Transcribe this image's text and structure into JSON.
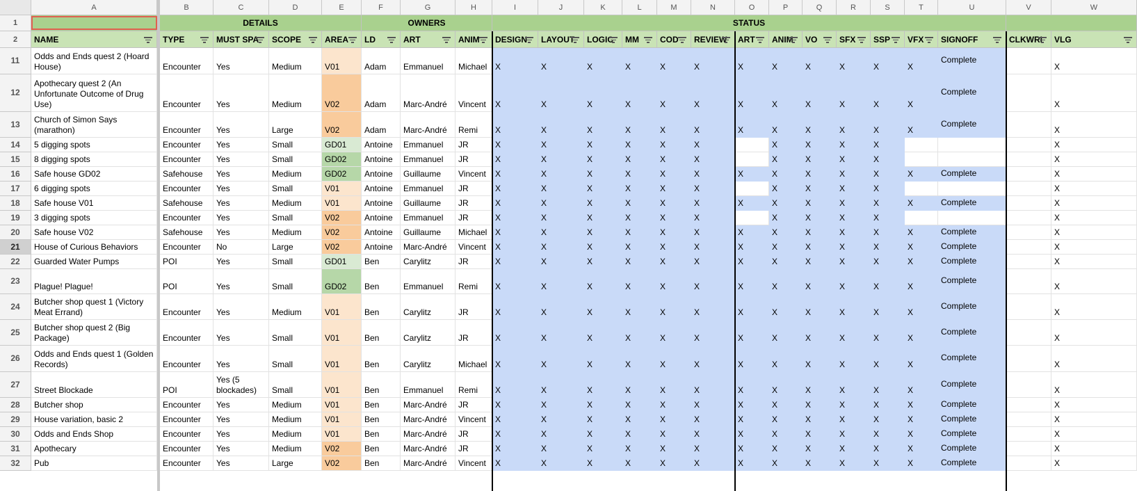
{
  "columns": {
    "letters": [
      "A",
      "B",
      "C",
      "D",
      "E",
      "F",
      "G",
      "H",
      "I",
      "J",
      "K",
      "L",
      "M",
      "N",
      "O",
      "P",
      "Q",
      "R",
      "S",
      "T",
      "U",
      "V",
      "W"
    ]
  },
  "groups": {
    "row_number": "1",
    "details": "DETAILS",
    "owners": "OWNERS",
    "status": "STATUS"
  },
  "headers": {
    "row_number": "2",
    "labels": [
      "NAME",
      "TYPE",
      "MUST SPA",
      "SCOPE",
      "AREA",
      "LD",
      "ART",
      "ANIM",
      "DESIGN",
      "LAYOUT",
      "LOGIC",
      "MM",
      "COD",
      "REVIEW",
      "ART",
      "ANIM",
      "VO",
      "SFX",
      "SSP",
      "VFX",
      "SIGNOFF",
      "CLKWRI",
      "VLG"
    ]
  },
  "rows": [
    {
      "n": "11",
      "name": "Odds and Ends quest 2 (Hoard House)",
      "type": "Encounter",
      "must": "Yes",
      "scope": "Medium",
      "area": "V01",
      "ld": "Adam",
      "art": "Emmanuel",
      "anim": "Michael",
      "design": "X",
      "layout": "X",
      "logic": "X",
      "mm": "X",
      "cod": "X",
      "review": "X",
      "art2": "X",
      "anim2": "X",
      "vo": "X",
      "sfx": "X",
      "ssp": "X",
      "vfx": "X",
      "signoff": "Complete",
      "clk": "",
      "vlg": "X"
    },
    {
      "n": "12",
      "name": "Apothecary quest 2 (An Unfortunate Outcome of Drug Use)",
      "type": "Encounter",
      "must": "Yes",
      "scope": "Medium",
      "area": "V02",
      "ld": "Adam",
      "art": "Marc-André",
      "anim": "Vincent",
      "design": "X",
      "layout": "X",
      "logic": "X",
      "mm": "X",
      "cod": "X",
      "review": "X",
      "art2": "X",
      "anim2": "X",
      "vo": "X",
      "sfx": "X",
      "ssp": "X",
      "vfx": "X",
      "signoff": "Complete",
      "clk": "",
      "vlg": "X"
    },
    {
      "n": "13",
      "name": "Church of Simon Says (marathon)",
      "type": "Encounter",
      "must": "Yes",
      "scope": "Large",
      "area": "V02",
      "ld": "Adam",
      "art": "Marc-André",
      "anim": "Remi",
      "design": "X",
      "layout": "X",
      "logic": "X",
      "mm": "X",
      "cod": "X",
      "review": "X",
      "art2": "X",
      "anim2": "X",
      "vo": "X",
      "sfx": "X",
      "ssp": "X",
      "vfx": "X",
      "signoff": "Complete",
      "clk": "",
      "vlg": "X"
    },
    {
      "n": "14",
      "name": "5 digging spots",
      "type": "Encounter",
      "must": "Yes",
      "scope": "Small",
      "area": "GD01",
      "ld": "Antoine",
      "art": "Emmanuel",
      "anim": "JR",
      "design": "X",
      "layout": "X",
      "logic": "X",
      "mm": "X",
      "cod": "X",
      "review": "X",
      "art2": "",
      "anim2": "X",
      "vo": "X",
      "sfx": "X",
      "ssp": "X",
      "vfx": "",
      "signoff": "",
      "clk": "",
      "vlg": "X"
    },
    {
      "n": "15",
      "name": "8 digging spots",
      "type": "Encounter",
      "must": "Yes",
      "scope": "Small",
      "area": "GD02",
      "ld": "Antoine",
      "art": "Emmanuel",
      "anim": "JR",
      "design": "X",
      "layout": "X",
      "logic": "X",
      "mm": "X",
      "cod": "X",
      "review": "X",
      "art2": "",
      "anim2": "X",
      "vo": "X",
      "sfx": "X",
      "ssp": "X",
      "vfx": "",
      "signoff": "",
      "clk": "",
      "vlg": "X"
    },
    {
      "n": "16",
      "name": "Safe house GD02",
      "type": "Safehouse",
      "must": "Yes",
      "scope": "Medium",
      "area": "GD02",
      "ld": "Antoine",
      "art": "Guillaume",
      "anim": "Vincent",
      "design": "X",
      "layout": "X",
      "logic": "X",
      "mm": "X",
      "cod": "X",
      "review": "X",
      "art2": "X",
      "anim2": "X",
      "vo": "X",
      "sfx": "X",
      "ssp": "X",
      "vfx": "X",
      "signoff": "Complete",
      "clk": "",
      "vlg": "X"
    },
    {
      "n": "17",
      "name": "6 digging spots",
      "type": "Encounter",
      "must": "Yes",
      "scope": "Small",
      "area": "V01",
      "ld": "Antoine",
      "art": "Emmanuel",
      "anim": "JR",
      "design": "X",
      "layout": "X",
      "logic": "X",
      "mm": "X",
      "cod": "X",
      "review": "X",
      "art2": "",
      "anim2": "X",
      "vo": "X",
      "sfx": "X",
      "ssp": "X",
      "vfx": "",
      "signoff": "",
      "clk": "",
      "vlg": "X"
    },
    {
      "n": "18",
      "name": "Safe house V01",
      "type": "Safehouse",
      "must": "Yes",
      "scope": "Medium",
      "area": "V01",
      "ld": "Antoine",
      "art": "Guillaume",
      "anim": "JR",
      "design": "X",
      "layout": "X",
      "logic": "X",
      "mm": "X",
      "cod": "X",
      "review": "X",
      "art2": "X",
      "anim2": "X",
      "vo": "X",
      "sfx": "X",
      "ssp": "X",
      "vfx": "X",
      "signoff": "Complete",
      "clk": "",
      "vlg": "X"
    },
    {
      "n": "19",
      "name": "3 digging spots",
      "type": "Encounter",
      "must": "Yes",
      "scope": "Small",
      "area": "V02",
      "ld": "Antoine",
      "art": "Emmanuel",
      "anim": "JR",
      "design": "X",
      "layout": "X",
      "logic": "X",
      "mm": "X",
      "cod": "X",
      "review": "X",
      "art2": "",
      "anim2": "X",
      "vo": "X",
      "sfx": "X",
      "ssp": "X",
      "vfx": "",
      "signoff": "",
      "clk": "",
      "vlg": "X"
    },
    {
      "n": "20",
      "name": "Safe house V02",
      "type": "Safehouse",
      "must": "Yes",
      "scope": "Medium",
      "area": "V02",
      "ld": "Antoine",
      "art": "Guillaume",
      "anim": "Michael",
      "design": "X",
      "layout": "X",
      "logic": "X",
      "mm": "X",
      "cod": "X",
      "review": "X",
      "art2": "X",
      "anim2": "X",
      "vo": "X",
      "sfx": "X",
      "ssp": "X",
      "vfx": "X",
      "signoff": "Complete",
      "clk": "",
      "vlg": "X"
    },
    {
      "n": "21",
      "name": "House of Curious Behaviors",
      "type": "Encounter",
      "must": "No",
      "scope": "Large",
      "area": "V02",
      "ld": "Antoine",
      "art": "Marc-André",
      "anim": "Vincent",
      "design": "X",
      "layout": "X",
      "logic": "X",
      "mm": "X",
      "cod": "X",
      "review": "X",
      "art2": "X",
      "anim2": "X",
      "vo": "X",
      "sfx": "X",
      "ssp": "X",
      "vfx": "X",
      "signoff": "Complete",
      "clk": "",
      "vlg": "X"
    },
    {
      "n": "22",
      "name": "Guarded Water Pumps",
      "type": "POI",
      "must": "Yes",
      "scope": "Small",
      "area": "GD01",
      "ld": "Ben",
      "art": "Carylitz",
      "anim": "JR",
      "design": "X",
      "layout": "X",
      "logic": "X",
      "mm": "X",
      "cod": "X",
      "review": "X",
      "art2": "X",
      "anim2": "X",
      "vo": "X",
      "sfx": "X",
      "ssp": "X",
      "vfx": "X",
      "signoff": "Complete",
      "clk": "",
      "vlg": "X"
    },
    {
      "n": "23",
      "name": "Plague! Plague!",
      "type": "POI",
      "must": "Yes",
      "scope": "Small",
      "area": "GD02",
      "ld": "Ben",
      "art": "Emmanuel",
      "anim": "Remi",
      "design": "X",
      "layout": "X",
      "logic": "X",
      "mm": "X",
      "cod": "X",
      "review": "X",
      "art2": "X",
      "anim2": "X",
      "vo": "X",
      "sfx": "X",
      "ssp": "X",
      "vfx": "X",
      "signoff": "Complete",
      "clk": "",
      "vlg": "X"
    },
    {
      "n": "24",
      "name": "Butcher shop quest 1 (Victory Meat Errand)",
      "type": "Encounter",
      "must": "Yes",
      "scope": "Medium",
      "area": "V01",
      "ld": "Ben",
      "art": "Carylitz",
      "anim": "JR",
      "design": "X",
      "layout": "X",
      "logic": "X",
      "mm": "X",
      "cod": "X",
      "review": "X",
      "art2": "X",
      "anim2": "X",
      "vo": "X",
      "sfx": "X",
      "ssp": "X",
      "vfx": "X",
      "signoff": "Complete",
      "clk": "",
      "vlg": "X"
    },
    {
      "n": "25",
      "name": "Butcher shop quest 2 (Big Package)",
      "type": "Encounter",
      "must": "Yes",
      "scope": "Small",
      "area": "V01",
      "ld": "Ben",
      "art": "Carylitz",
      "anim": "JR",
      "design": "X",
      "layout": "X",
      "logic": "X",
      "mm": "X",
      "cod": "X",
      "review": "X",
      "art2": "X",
      "anim2": "X",
      "vo": "X",
      "sfx": "X",
      "ssp": "X",
      "vfx": "X",
      "signoff": "Complete",
      "clk": "",
      "vlg": "X"
    },
    {
      "n": "26",
      "name": "Odds and Ends quest 1 (Golden Records)",
      "type": "Encounter",
      "must": "Yes",
      "scope": "Small",
      "area": "V01",
      "ld": "Ben",
      "art": "Carylitz",
      "anim": "Michael",
      "design": "X",
      "layout": "X",
      "logic": "X",
      "mm": "X",
      "cod": "X",
      "review": "X",
      "art2": "X",
      "anim2": "X",
      "vo": "X",
      "sfx": "X",
      "ssp": "X",
      "vfx": "X",
      "signoff": "Complete",
      "clk": "",
      "vlg": "X"
    },
    {
      "n": "27",
      "name": "Street Blockade",
      "type": "POI",
      "must": "Yes (5 blockades)",
      "scope": "Small",
      "area": "V01",
      "ld": "Ben",
      "art": "Emmanuel",
      "anim": "Remi",
      "design": "X",
      "layout": "X",
      "logic": "X",
      "mm": "X",
      "cod": "X",
      "review": "X",
      "art2": "X",
      "anim2": "X",
      "vo": "X",
      "sfx": "X",
      "ssp": "X",
      "vfx": "X",
      "signoff": "Complete",
      "clk": "",
      "vlg": "X"
    },
    {
      "n": "28",
      "name": "Butcher shop",
      "type": "Encounter",
      "must": "Yes",
      "scope": "Medium",
      "area": "V01",
      "ld": "Ben",
      "art": "Marc-André",
      "anim": "JR",
      "design": "X",
      "layout": "X",
      "logic": "X",
      "mm": "X",
      "cod": "X",
      "review": "X",
      "art2": "X",
      "anim2": "X",
      "vo": "X",
      "sfx": "X",
      "ssp": "X",
      "vfx": "X",
      "signoff": "Complete",
      "clk": "",
      "vlg": "X"
    },
    {
      "n": "29",
      "name": "House variation, basic 2",
      "type": "Encounter",
      "must": "Yes",
      "scope": "Medium",
      "area": "V01",
      "ld": "Ben",
      "art": "Marc-André",
      "anim": "Vincent",
      "design": "X",
      "layout": "X",
      "logic": "X",
      "mm": "X",
      "cod": "X",
      "review": "X",
      "art2": "X",
      "anim2": "X",
      "vo": "X",
      "sfx": "X",
      "ssp": "X",
      "vfx": "X",
      "signoff": "Complete",
      "clk": "",
      "vlg": "X"
    },
    {
      "n": "30",
      "name": "Odds and Ends Shop",
      "type": "Encounter",
      "must": "Yes",
      "scope": "Medium",
      "area": "V01",
      "ld": "Ben",
      "art": "Marc-André",
      "anim": "JR",
      "design": "X",
      "layout": "X",
      "logic": "X",
      "mm": "X",
      "cod": "X",
      "review": "X",
      "art2": "X",
      "anim2": "X",
      "vo": "X",
      "sfx": "X",
      "ssp": "X",
      "vfx": "X",
      "signoff": "Complete",
      "clk": "",
      "vlg": "X"
    },
    {
      "n": "31",
      "name": "Apothecary",
      "type": "Encounter",
      "must": "Yes",
      "scope": "Medium",
      "area": "V02",
      "ld": "Ben",
      "art": "Marc-André",
      "anim": "JR",
      "design": "X",
      "layout": "X",
      "logic": "X",
      "mm": "X",
      "cod": "X",
      "review": "X",
      "art2": "X",
      "anim2": "X",
      "vo": "X",
      "sfx": "X",
      "ssp": "X",
      "vfx": "X",
      "signoff": "Complete",
      "clk": "",
      "vlg": "X"
    },
    {
      "n": "32",
      "name": "Pub",
      "type": "Encounter",
      "must": "Yes",
      "scope": "Large",
      "area": "V02",
      "ld": "Ben",
      "art": "Marc-André",
      "anim": "Vincent",
      "design": "X",
      "layout": "X",
      "logic": "X",
      "mm": "X",
      "cod": "X",
      "review": "X",
      "art2": "X",
      "anim2": "X",
      "vo": "X",
      "sfx": "X",
      "ssp": "X",
      "vfx": "X",
      "signoff": "Complete",
      "clk": "",
      "vlg": "X"
    }
  ],
  "colors": {
    "group_header": "#a9d18e",
    "column_header": "#c9e3b5",
    "status_fill": "#c9daf8",
    "area_v01": "#fce5cd",
    "area_v02": "#f9cb9c",
    "area_gd01": "#d9ead3",
    "area_gd02": "#b6d7a8",
    "selection_border": "#e06050"
  },
  "icons": {
    "filter": "filter-icon"
  }
}
